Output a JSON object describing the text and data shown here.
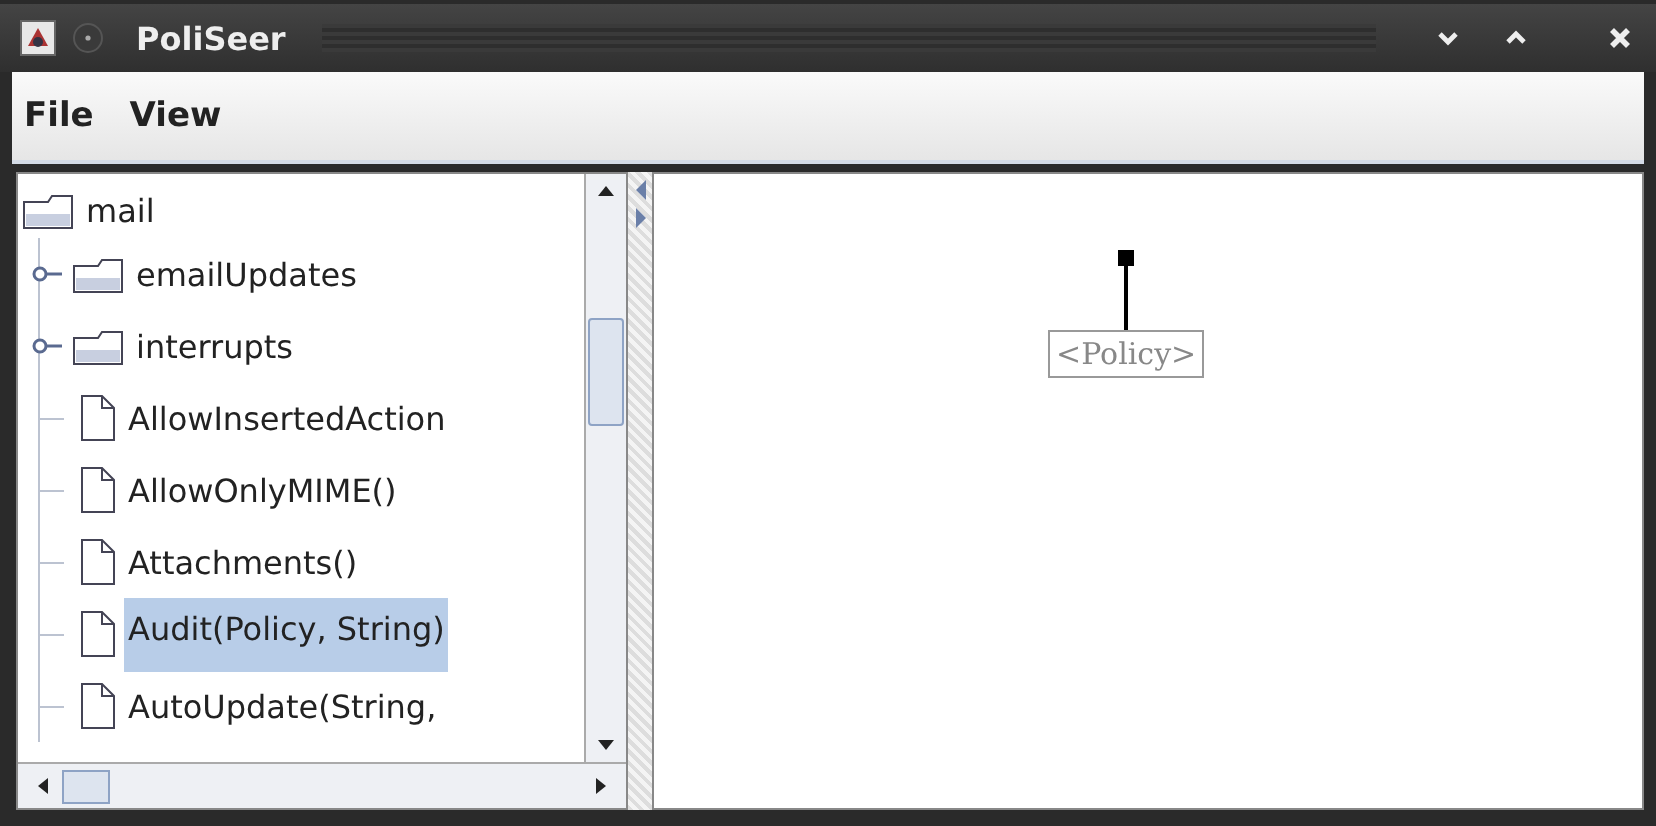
{
  "window": {
    "title": "PoliSeer"
  },
  "menu": [
    "File",
    "View"
  ],
  "tree": {
    "label": "mail",
    "children": [
      {
        "label": "emailUpdates",
        "kind": "folder",
        "expanded": false,
        "selected": false
      },
      {
        "label": "interrupts",
        "kind": "folder",
        "expanded": false,
        "selected": false
      },
      {
        "label": "AllowInsertedAction",
        "kind": "leaf",
        "selected": false
      },
      {
        "label": "AllowOnlyMIME()",
        "kind": "leaf",
        "selected": false
      },
      {
        "label": "Attachments()",
        "kind": "leaf",
        "selected": false
      },
      {
        "label": "Audit(Policy, String)",
        "kind": "leaf",
        "selected": true
      },
      {
        "label": "AutoUpdate(String,",
        "kind": "leaf",
        "selected": false
      }
    ]
  },
  "canvas": {
    "node": {
      "label": "<Policy>"
    }
  }
}
